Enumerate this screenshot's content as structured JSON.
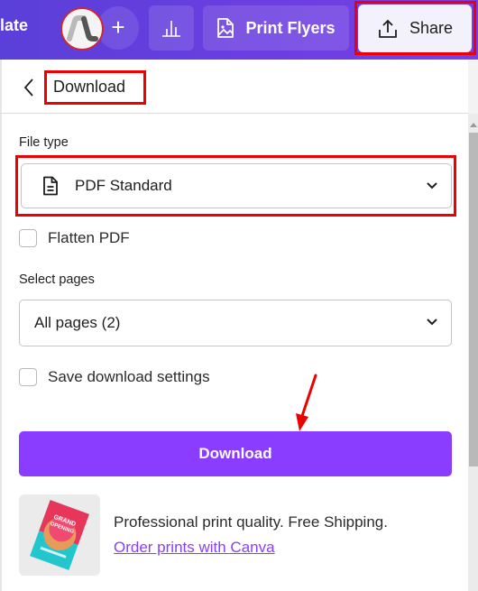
{
  "topbar": {
    "partial_label": "late",
    "avatar_alt": "user-avatar",
    "add_icon": "+",
    "insights_icon": "bar-chart-icon",
    "print_button_label": "Print Flyers",
    "print_icon": "image-document-icon",
    "share_button_label": "Share",
    "share_icon": "upload-icon"
  },
  "panel": {
    "title": "Download",
    "back_icon": "chevron-left-icon",
    "file_type": {
      "label": "File type",
      "selected": "PDF Standard",
      "icon": "document-icon"
    },
    "flatten_pdf": {
      "label": "Flatten PDF",
      "checked": false
    },
    "select_pages": {
      "label": "Select pages",
      "selected": "All pages (2)"
    },
    "save_settings": {
      "label": "Save download settings",
      "checked": false
    },
    "download_button_label": "Download",
    "promo": {
      "text": "Professional print quality. Free Shipping.",
      "link": "Order prints with Canva",
      "thumb_headline": "GRAND OPENING"
    }
  },
  "colors": {
    "topbar_start": "#5a3fd8",
    "topbar_end": "#7740e6",
    "accent": "#8b3dff",
    "highlight": "#ee0000",
    "share_bg": "#f3f1fb"
  }
}
